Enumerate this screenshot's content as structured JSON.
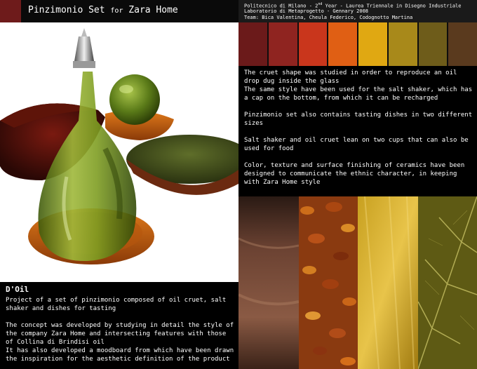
{
  "title": {
    "main": "Pinzimonio Set",
    "for": "for",
    "brand": "Zara Home"
  },
  "header_info": [
    "Politecnico di Milano - 2nd Year - Laurea Triennale in Disegno Industriale",
    "Laboratorio di Metaprogetto - Gennary 2008",
    "Team: Bica Valentina, Cheula Federico, Codognotto Martina"
  ],
  "palette": [
    "#6b1a1a",
    "#8f2420",
    "#c9361c",
    "#e05f14",
    "#e0a812",
    "#a8891a",
    "#6e5c1a",
    "#5a3a1e"
  ],
  "left_panel": {
    "heading": "D'Oil",
    "paragraphs": [
      "Project of a set of pinzimonio composed of oil cruet, salt shaker and dishes for tasting",
      "",
      "The concept was developed by studying in detail the style of the company Zara Home and intersecting features with those of Collina di Brindisi oil",
      "It has also developed a moodboard from which have been drawn the inspiration for the aesthetic definition of the product"
    ]
  },
  "right_panel": {
    "paragraphs": [
      "The cruet shape was studied in order to reproduce an oil drop dug inside the glass",
      "The same style have been used for the salt shaker, which has a cap on the bottom, from which it can be recharged",
      "",
      "Pinzimonio set also contains tasting dishes in two different sizes",
      "",
      "Salt shaker and oil cruet lean on two cups that can also be used for food",
      "",
      "Color, texture and surface finishing of ceramics have been designed to communicate the ethnic character, in keeping with Zara Home style"
    ]
  }
}
